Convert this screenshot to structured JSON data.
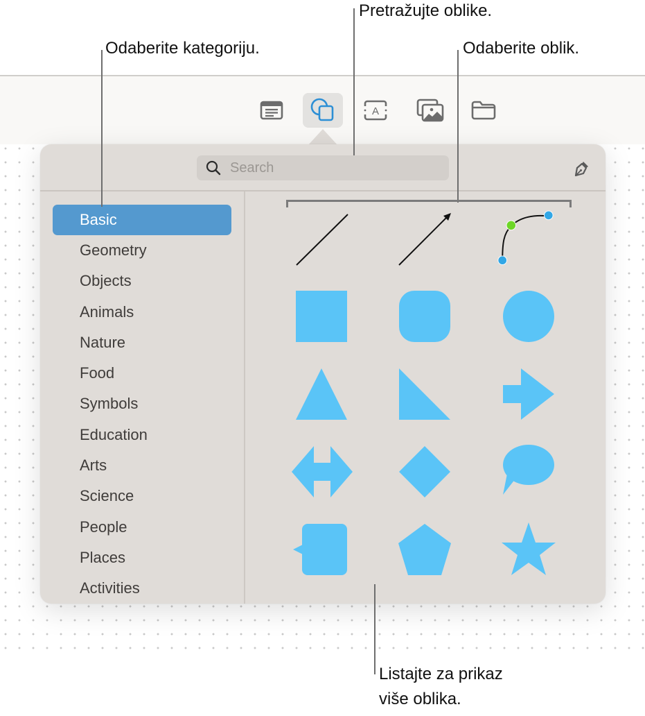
{
  "callouts": {
    "category": "Odaberite kategoriju.",
    "search": "Pretražujte oblike.",
    "shape": "Odaberite oblik.",
    "scroll_line1": "Listajte za prikaz",
    "scroll_line2": "više oblika."
  },
  "toolbar": {
    "buttons": [
      {
        "name": "text-box",
        "icon": "text-box-icon",
        "active": false
      },
      {
        "name": "shape",
        "icon": "shapes-icon",
        "active": true
      },
      {
        "name": "text",
        "icon": "text-icon",
        "active": false
      },
      {
        "name": "media",
        "icon": "media-icon",
        "active": false
      },
      {
        "name": "files",
        "icon": "folder-icon",
        "active": false
      }
    ]
  },
  "panel": {
    "search": {
      "placeholder": "Search",
      "value": ""
    },
    "draw_button_icon": "pen-icon",
    "categories": [
      {
        "label": "Basic",
        "selected": true
      },
      {
        "label": "Geometry",
        "selected": false
      },
      {
        "label": "Objects",
        "selected": false
      },
      {
        "label": "Animals",
        "selected": false
      },
      {
        "label": "Nature",
        "selected": false
      },
      {
        "label": "Food",
        "selected": false
      },
      {
        "label": "Symbols",
        "selected": false
      },
      {
        "label": "Education",
        "selected": false
      },
      {
        "label": "Arts",
        "selected": false
      },
      {
        "label": "Science",
        "selected": false
      },
      {
        "label": "People",
        "selected": false
      },
      {
        "label": "Places",
        "selected": false
      },
      {
        "label": "Activities",
        "selected": false
      }
    ],
    "shapes": [
      "line",
      "arrow-line",
      "curve",
      "square",
      "rounded-square",
      "circle",
      "triangle",
      "right-triangle",
      "arrow-right",
      "double-arrow",
      "diamond",
      "speech-bubble",
      "callout-square",
      "pentagon",
      "star"
    ],
    "colors": {
      "shape_fill": "#5ac4f7",
      "selected_category": "#5499cf",
      "accent_icon": "#2d8fd5",
      "curve_handle": "#32a7e6",
      "curve_control": "#6dd627"
    }
  }
}
